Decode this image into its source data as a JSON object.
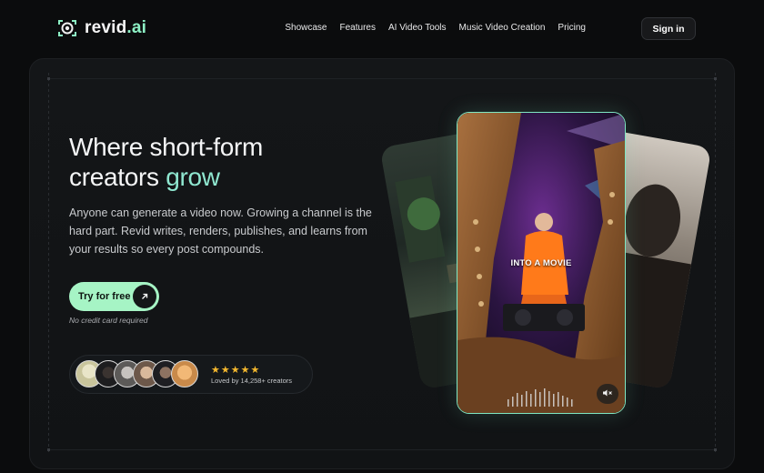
{
  "brand": {
    "name_main": "revid",
    "name_tld": ".ai",
    "accent": "#8df0c4"
  },
  "nav": {
    "links": [
      "Showcase",
      "Features",
      "AI Video Tools",
      "Music Video Creation",
      "Pricing"
    ],
    "signin_label": "Sign in"
  },
  "hero": {
    "headline_line1": "Where short-form",
    "headline_line2_prefix": "creators ",
    "headline_accent": "grow",
    "description": "Anyone can generate a video now. Growing a channel is the hard part. Revid writes, renders, publishes, and learns from your results so every post compounds.",
    "cta_label": "Try for free",
    "cta_icon": "arrow-up-right-icon",
    "note": "No credit card required"
  },
  "social_proof": {
    "rating_stars": 5,
    "loved_text": "Loved by 14,258+ creators",
    "avatar_count": 6
  },
  "preview": {
    "caption_part1": "INTO",
    "caption_part2": " A MOVIE",
    "mute_icon": "speaker-muted-icon"
  },
  "colors": {
    "cta_bg": "#a6f4c5",
    "headline_accent": "#8fe7d0",
    "star": "#f5b82e",
    "phone_border": "#7fe6c2"
  }
}
